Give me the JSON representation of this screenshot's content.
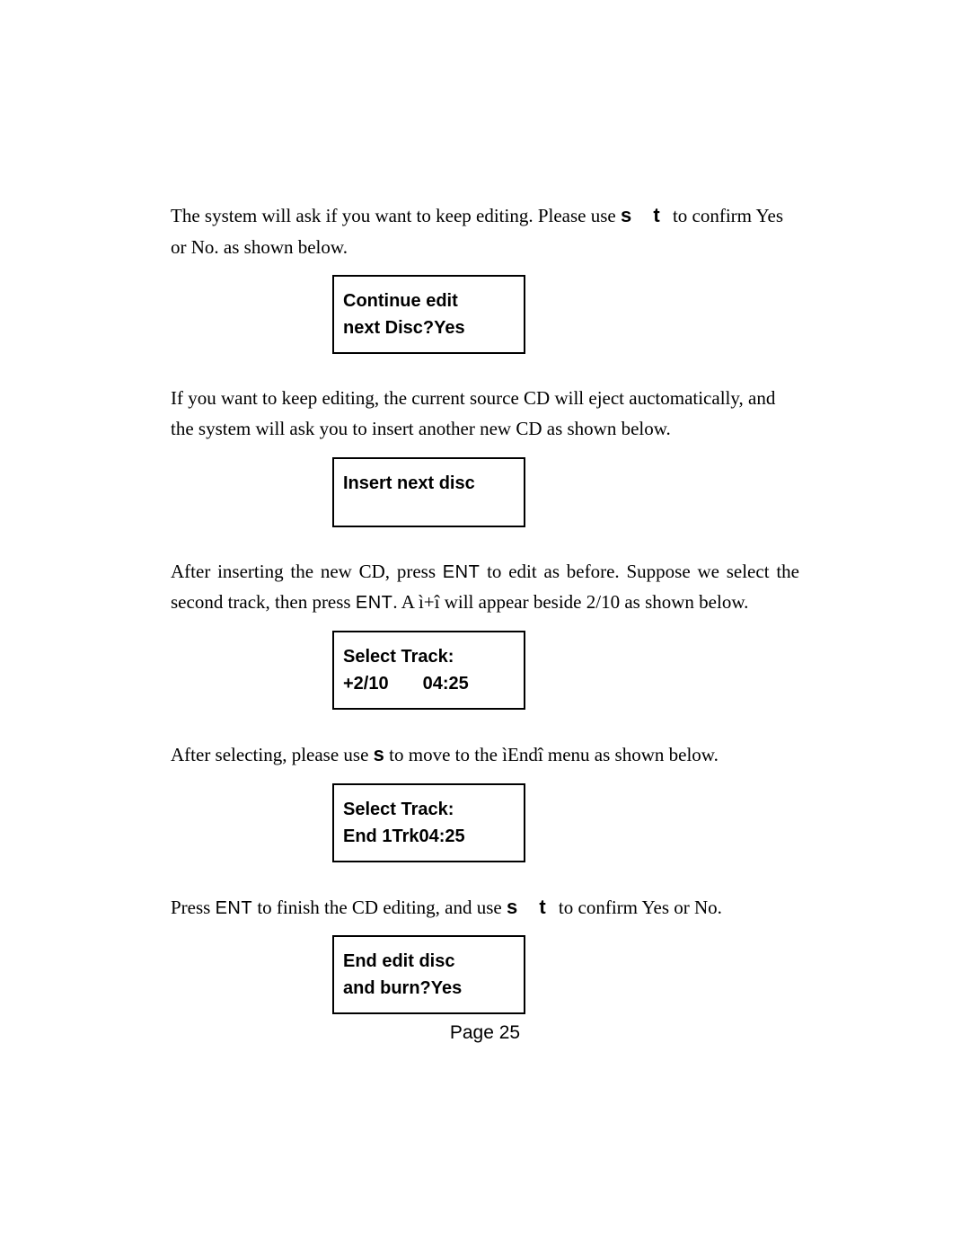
{
  "paragraphs": {
    "p1_a": "The system will ask if you want to keep editing. Please use ",
    "p1_key": "s t",
    "p1_b": " to confirm Yes or No. as shown below.",
    "p2": "If you want to keep editing, the current source CD will eject auctomatically, and the system will ask you to insert another new CD as shown below.",
    "p3_a": "After inserting the new CD, press ",
    "p3_key1": "ENT",
    "p3_b": " to edit as before. Suppose we select the second track, then press ",
    "p3_key2": "ENT",
    "p3_c": ". A ì+î will appear beside 2/10 as shown below.",
    "p4_a": "After selecting, please use ",
    "p4_key": "s",
    "p4_b": " to move to the ìEndî menu as shown below.",
    "p5_a": "Press ",
    "p5_key1": "ENT",
    "p5_b": " to finish the CD editing, and use ",
    "p5_key2": "s t",
    "p5_c": " to confirm Yes or No."
  },
  "boxes": {
    "box1_line1": "Continue edit",
    "box1_line2": "next Disc?Yes",
    "box2_line1": "Insert next disc",
    "box3_line1": "Select Track:",
    "box3_line2a": "+2/10",
    "box3_line2b": "04:25",
    "box4_line1": "Select Track:",
    "box4_line2": "End  1Trk04:25",
    "box5_line1": "End edit disc",
    "box5_line2": "and burn?Yes"
  },
  "footer": {
    "label": "Page 25"
  }
}
